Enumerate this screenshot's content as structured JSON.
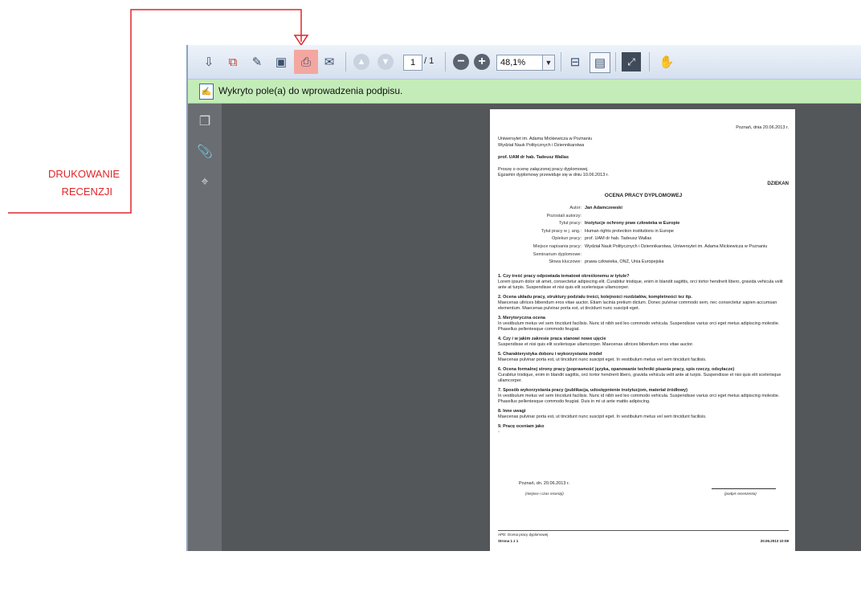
{
  "annotation": {
    "label_line1": "DRUKOWANIE",
    "label_line2": "RECENZJI",
    "color": "#e0262a"
  },
  "toolbar": {
    "buttons": [
      "save-copy-icon",
      "export-icon",
      "sign-icon",
      "save-icon",
      "print-icon",
      "email-icon",
      "prev-page-icon",
      "next-page-icon",
      "zoom-out-icon",
      "zoom-in-icon",
      "fit-page-icon",
      "page-view-icon",
      "fullscreen-icon",
      "hand-tool-icon"
    ],
    "highlight_color": "#f4a6a0",
    "page_current": "1",
    "page_total": "/ 1",
    "zoom": "48,1%"
  },
  "message_bar": {
    "text": "Wykryto pole(a) do wprowadzenia podpisu.",
    "color": "#c4ecb9"
  },
  "document": {
    "date_line": "Poznań, dnia 20.06.2013 r.",
    "university": "Uniwersytet im. Adama Mickiewicza w Poznaniu",
    "faculty": "Wydział Nauk Politycznych i Dziennikarstwa",
    "addressee": "prof. UAM dr hab. Tadeusz Wallas",
    "request_1": "Proszę o ocenę załączonej pracy dyplomowej.",
    "request_2": "Egzamin dyplomowy przewiduje się w dniu 10.06.2013 r.",
    "to": "DZIEKAN",
    "title": "OCENA PRACY DYPLOMOWEJ",
    "meta": [
      {
        "k": "Autor:",
        "v": "Jan Adamczewski",
        "bold": true
      },
      {
        "k": "Pozostali autorzy:",
        "v": "",
        "bold": false
      },
      {
        "k": "Tytuł pracy:",
        "v": "Instytucje ochrony praw człowieka w Europie",
        "bold": true
      },
      {
        "k": "Tytuł pracy w j. ang.:",
        "v": "Human rights protection institutions in Europe",
        "bold": false
      },
      {
        "k": "Opiekun pracy:",
        "v": "prof. UAM dr hab. Tadeusz Wallas",
        "bold": false
      },
      {
        "k": "Miejsce napisania pracy:",
        "v": "Wydział Nauk Politycznych i Dziennikarstwa, Uniwersytet im. Adama Mickiewicza w Poznaniu",
        "bold": false
      },
      {
        "k": "Seminarium dyplomowe:",
        "v": "",
        "bold": false
      },
      {
        "k": "Słowa kluczowe:",
        "v": "prawa człowieka, ONZ, Unia Europejska",
        "bold": false
      }
    ],
    "sections": [
      {
        "h": "1. Czy treść pracy odpowiada tematowi określonemu w tytule?",
        "t": "Lorem ipsum dolor sit amet, consectetur adipiscing elit. Curabitur tristique, enim in blandit sagittis, orci tortor hendrerit libero, gravida vehicula velit ante at turpis. Suspendisse et nisi quis elit scelerisque ullamcorper."
      },
      {
        "h": "2. Ocena układu pracy, struktury podziału treści, kolejności rozdziałów, kompletności tez itp.",
        "t": "Maecenas ultrices bibendum eros vitae auctor. Etiam lacinia pretium dictum. Donec pulvinar commodo sem, nec consectetur sapien accumsan elementum. Maecenas pulvinar porta est, ut tincidunt nunc suscipit eget."
      },
      {
        "h": "3. Merytoryczna ocena",
        "t": "In vestibulum metus vel sem tincidunt facilisis. Nunc id nibh sed leo commodo vehicula. Suspendisse varius orci eget metus adipiscing molestie. Phasellus pellentesque commodo feugiat."
      },
      {
        "h": "4. Czy i w jakim zakresie praca stanowi nowe ujęcie",
        "t": "Suspendisse et nisi quis elit scelerisque ullamcorper. Maecenas ultrices bibendum eros vitae auctor."
      },
      {
        "h": "5. Charakterystyka doboru i wykorzystania źródeł",
        "t": "Maecenas pulvinar porta est, ut tincidunt nunc suscipit eget. In vestibulum metus vel sem tincidunt facilisis."
      },
      {
        "h": "6. Ocena formalnej strony pracy (poprawność języka, opanowanie techniki pisania pracy, spis rzeczy, odsyłacze)",
        "t": "Curabitur tristique, enim in blandit sagittis, orci tortor hendrerit libero, gravida vehicula velit ante at turpis. Suspendisse et nisi quis elit scelerisque ullamcorper."
      },
      {
        "h": "7. Sposób wykorzystania pracy (publikacja, udostępnienie instytucjom, materiał źródłowy)",
        "t": "In vestibulum metus vel sem tincidunt facilisis. Nunc id nibh sed leo commodo vehicula. Suspendisse varius orci eget metus adipiscing molestie. Phasellus pellentesque commodo feugiat. Duis in mi ut ante mattis adipiscing."
      },
      {
        "h": "8. Inne uwagi",
        "t": "Maecenas pulvinar porta est, ut tincidunt nunc suscipit eget. In vestibulum metus vel sem tincidunt facilisis."
      },
      {
        "h": "9. Pracę oceniam jako",
        "t": "-"
      }
    ],
    "place_date": "Poznań, dn. 20.06.2013 r.",
    "place_caption": "(miejsce i czas recenzji)",
    "sign_caption": "(podpis recenzenta)",
    "footer_doc": "APD: Ocena pracy dyplomowej",
    "footer_page": "Strona 1 z 1",
    "footer_date": "20.06.2013 10:08"
  }
}
